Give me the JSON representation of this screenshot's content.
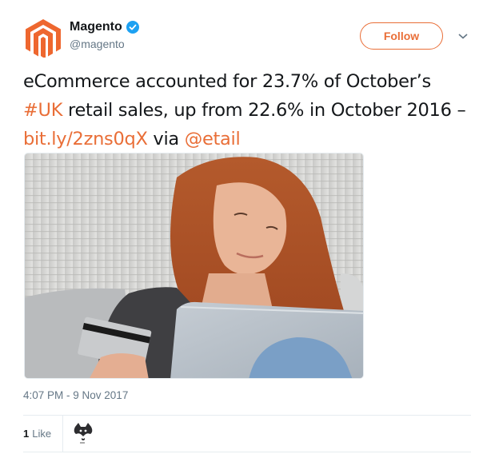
{
  "author": {
    "display_name": "Magento",
    "handle": "@magento",
    "verified": true,
    "logo_icon": "magento-logo-icon",
    "brand_color": "#e96e37"
  },
  "header": {
    "follow_label": "Follow",
    "menu_icon": "chevron-down-icon"
  },
  "tweet": {
    "segments": [
      {
        "type": "text",
        "value": "eCommerce accounted for 23.7% of October’s "
      },
      {
        "type": "hashtag",
        "value": "#UK"
      },
      {
        "type": "text",
        "value": " retail sales, up from 22.6% in October 2016 – "
      },
      {
        "type": "link",
        "value": "bit.ly/2zns0qX"
      },
      {
        "type": "text",
        "value": " via "
      },
      {
        "type": "mention",
        "value": "@etail"
      }
    ],
    "link_color": "#e96e37",
    "media_description": "Smiling red-haired woman holding a credit card and a laptop"
  },
  "meta": {
    "timestamp": "4:07 PM - 9 Nov 2017"
  },
  "stats": {
    "likes_count": "1",
    "likes_label": "Like",
    "liker_avatar_icon": "cat-avatar-icon"
  }
}
